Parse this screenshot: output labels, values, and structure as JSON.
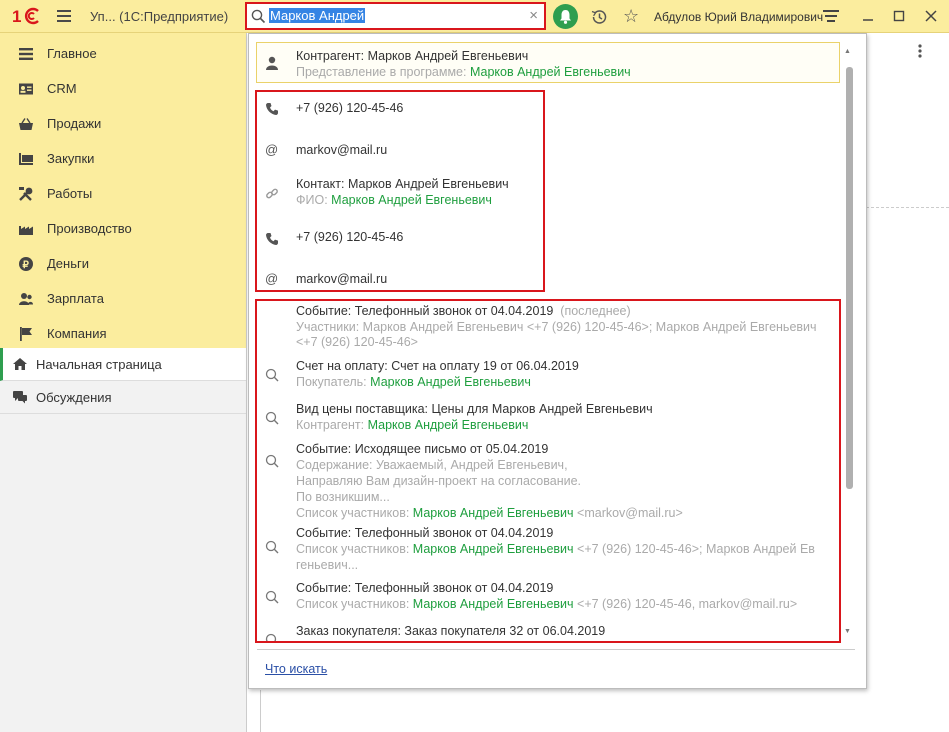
{
  "header": {
    "app_title": "Уп...  (1С:Предприятие)",
    "search_value": "Марков Андрей",
    "user_name": "Абдулов Юрий Владимирович"
  },
  "sidebar": {
    "sections": [
      {
        "label": "Главное",
        "icon": "hamburger-icon"
      },
      {
        "label": "CRM",
        "icon": "crm-icon"
      },
      {
        "label": "Продажи",
        "icon": "basket-icon"
      },
      {
        "label": "Закупки",
        "icon": "purchases-icon"
      },
      {
        "label": "Работы",
        "icon": "tools-icon"
      },
      {
        "label": "Производство",
        "icon": "factory-icon"
      },
      {
        "label": "Деньги",
        "icon": "money-icon"
      },
      {
        "label": "Зарплата",
        "icon": "people-icon"
      },
      {
        "label": "Компания",
        "icon": "flag-icon"
      }
    ],
    "nav": [
      {
        "label": "Начальная страница",
        "icon": "home-icon"
      },
      {
        "label": "Обсуждения",
        "icon": "chat-icon"
      }
    ]
  },
  "results": {
    "top": {
      "title": "Контрагент: Марков Андрей Евгеньевич",
      "label": "Представление в программе:",
      "value": "Марков Андрей Евгеньевич"
    },
    "contacts": [
      {
        "icon": "phone-icon",
        "text": "+7 (926) 120-45-46"
      },
      {
        "icon": "at-icon",
        "text": "markov@mail.ru"
      },
      {
        "icon": "link-icon",
        "text": "Контакт: Марков Андрей Евгеньевич",
        "label": "ФИО:",
        "value": "Марков Андрей Евгеньевич"
      },
      {
        "icon": "phone-icon",
        "text": "+7 (926) 120-45-46"
      },
      {
        "icon": "at-icon",
        "text": "markov@mail.ru"
      }
    ],
    "docs": [
      {
        "title": "Событие: Телефонный звонок от 04.04.2019",
        "suffix": "(последнее)",
        "line2": "Участники: Марков Андрей Евгеньевич <+7 (926) 120-45-46>; Марков Андрей Евгеньевич",
        "line3": "<+7 (926) 120-45-46>"
      },
      {
        "title": "Счет на оплату: Счет на оплату 19 от 06.04.2019",
        "label": "Покупатель:",
        "value": "Марков Андрей Евгеньевич"
      },
      {
        "title": "Вид цены поставщика: Цены для Марков Андрей Евгеньевич",
        "label": "Контрагент:",
        "value": "Марков Андрей Евгеньевич"
      },
      {
        "title": "Событие: Исходящее письмо от 05.04.2019",
        "line2": "Содержание: Уважаемый, Андрей Евгеньевич,",
        "line3": "Направляю Вам дизайн-проект на согласование.",
        "line4": "По возникшим...",
        "label": "Список участников:",
        "value": "Марков Андрей Евгеньевич",
        "rest": "<markov@mail.ru>"
      },
      {
        "title": "Событие: Телефонный звонок от 04.04.2019",
        "label": "Список участников:",
        "value": "Марков Андрей Евгеньевич",
        "rest": "<+7 (926) 120-45-46>; Марков Андрей Ев",
        "line3": "геньевич..."
      },
      {
        "title": "Событие: Телефонный звонок от 04.04.2019",
        "label": "Список участников:",
        "value": "Марков Андрей Евгеньевич",
        "rest": "<+7 (926) 120-45-46, markov@mail.ru>"
      },
      {
        "title": "Заказ покупателя: Заказ покупателя 32 от 06.04.2019"
      }
    ],
    "what_to_search": "Что искать"
  }
}
